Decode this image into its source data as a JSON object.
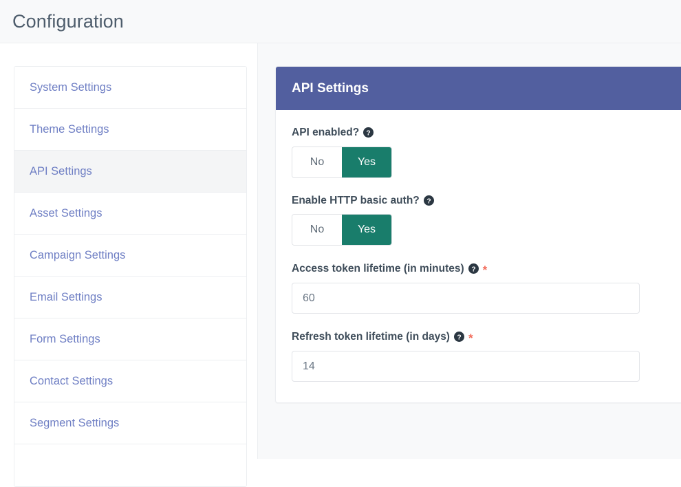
{
  "header": {
    "title": "Configuration"
  },
  "sidebar": {
    "items": [
      {
        "label": "System Settings",
        "active": false
      },
      {
        "label": "Theme Settings",
        "active": false
      },
      {
        "label": "API Settings",
        "active": true
      },
      {
        "label": "Asset Settings",
        "active": false
      },
      {
        "label": "Campaign Settings",
        "active": false
      },
      {
        "label": "Email Settings",
        "active": false
      },
      {
        "label": "Form Settings",
        "active": false
      },
      {
        "label": "Contact Settings",
        "active": false
      },
      {
        "label": "Segment Settings",
        "active": false
      },
      {
        "label": "",
        "active": false
      }
    ]
  },
  "panel": {
    "title": "API Settings",
    "fields": {
      "api_enabled": {
        "label": "API enabled?",
        "help_icon": "question-circle-icon",
        "required": false,
        "options": [
          "No",
          "Yes"
        ],
        "value": "Yes"
      },
      "http_basic_auth": {
        "label": "Enable HTTP basic auth?",
        "help_icon": "question-circle-icon",
        "required": false,
        "options": [
          "No",
          "Yes"
        ],
        "value": "Yes"
      },
      "access_token_lifetime": {
        "label": "Access token lifetime (in minutes)",
        "help_icon": "question-circle-icon",
        "required": true,
        "required_marker": "*",
        "value": "60",
        "placeholder": "60"
      },
      "refresh_token_lifetime": {
        "label": "Refresh token lifetime (in days)",
        "help_icon": "question-circle-icon",
        "required": true,
        "required_marker": "*",
        "value": "14",
        "placeholder": "14"
      }
    }
  },
  "colors": {
    "panel_header_bg": "#525f9f",
    "toggle_active_bg": "#197d6b",
    "sidebar_link": "#6f7fc4",
    "required_star": "#f26a59",
    "page_bg": "#f8f9fa"
  }
}
